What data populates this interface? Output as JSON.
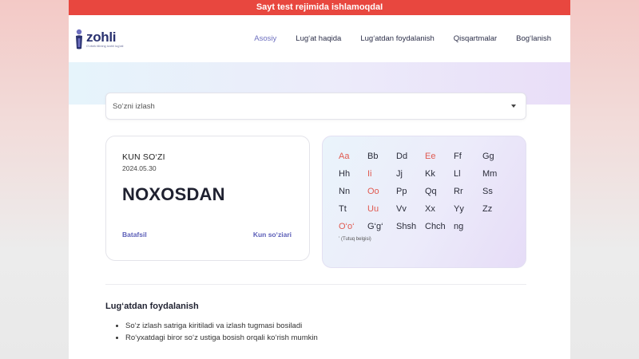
{
  "banner": {
    "text": "Sayt test rejimida ishlamoqdaI"
  },
  "logo": {
    "name": "zohli",
    "tagline": "O'zbek tilining izohli lug'ati"
  },
  "nav": {
    "items": [
      {
        "label": "Asosiy",
        "active": true
      },
      {
        "label": "Lug‘at haqida",
        "active": false
      },
      {
        "label": "Lug‘atdan foydalanish",
        "active": false
      },
      {
        "label": "Qisqartmalar",
        "active": false
      },
      {
        "label": "Bog‘lanish",
        "active": false
      }
    ]
  },
  "search": {
    "placeholder": "So‘zni izlash",
    "value": ""
  },
  "word_of_day": {
    "heading": "KUN SO‘ZI",
    "date": "2024.05.30",
    "word": "NOXOSDAN",
    "details_link": "Batafsil",
    "more_link": "Kun so‘ziari"
  },
  "alphabet": {
    "letters": [
      {
        "text": "Aa",
        "vowel": true
      },
      {
        "text": "Bb",
        "vowel": false
      },
      {
        "text": "Dd",
        "vowel": false
      },
      {
        "text": "Ee",
        "vowel": true
      },
      {
        "text": "Ff",
        "vowel": false
      },
      {
        "text": "Gg",
        "vowel": false
      },
      {
        "text": "Hh",
        "vowel": false
      },
      {
        "text": "Ii",
        "vowel": true
      },
      {
        "text": "Jj",
        "vowel": false
      },
      {
        "text": "Kk",
        "vowel": false
      },
      {
        "text": "Ll",
        "vowel": false
      },
      {
        "text": "Mm",
        "vowel": false
      },
      {
        "text": "Nn",
        "vowel": false
      },
      {
        "text": "Oo",
        "vowel": true
      },
      {
        "text": "Pp",
        "vowel": false
      },
      {
        "text": "Qq",
        "vowel": false
      },
      {
        "text": "Rr",
        "vowel": false
      },
      {
        "text": "Ss",
        "vowel": false
      },
      {
        "text": "Tt",
        "vowel": false
      },
      {
        "text": "Uu",
        "vowel": true
      },
      {
        "text": "Vv",
        "vowel": false
      },
      {
        "text": "Xx",
        "vowel": false
      },
      {
        "text": "Yy",
        "vowel": false
      },
      {
        "text": "Zz",
        "vowel": false
      },
      {
        "text": "O‘o‘",
        "vowel": true
      },
      {
        "text": "G‘g‘",
        "vowel": false
      },
      {
        "text": "Shsh",
        "vowel": false
      },
      {
        "text": "Chch",
        "vowel": false
      },
      {
        "text": "ng",
        "vowel": false
      }
    ],
    "note": "ʼ (Tutuq belgisi)"
  },
  "usage": {
    "title": "Lug‘atdan foydalanish",
    "items": [
      "So‘z izlash satriga kiritiladi va izlash tugmasi bosiladi",
      "Ro‘yxatdagi biror so‘z ustiga bosish orqali ko‘rish mumkin"
    ]
  },
  "colors": {
    "banner": "#e8473f",
    "accent": "#6d6fbf",
    "vowel": "#e05a50",
    "logo": "#2a3270"
  }
}
